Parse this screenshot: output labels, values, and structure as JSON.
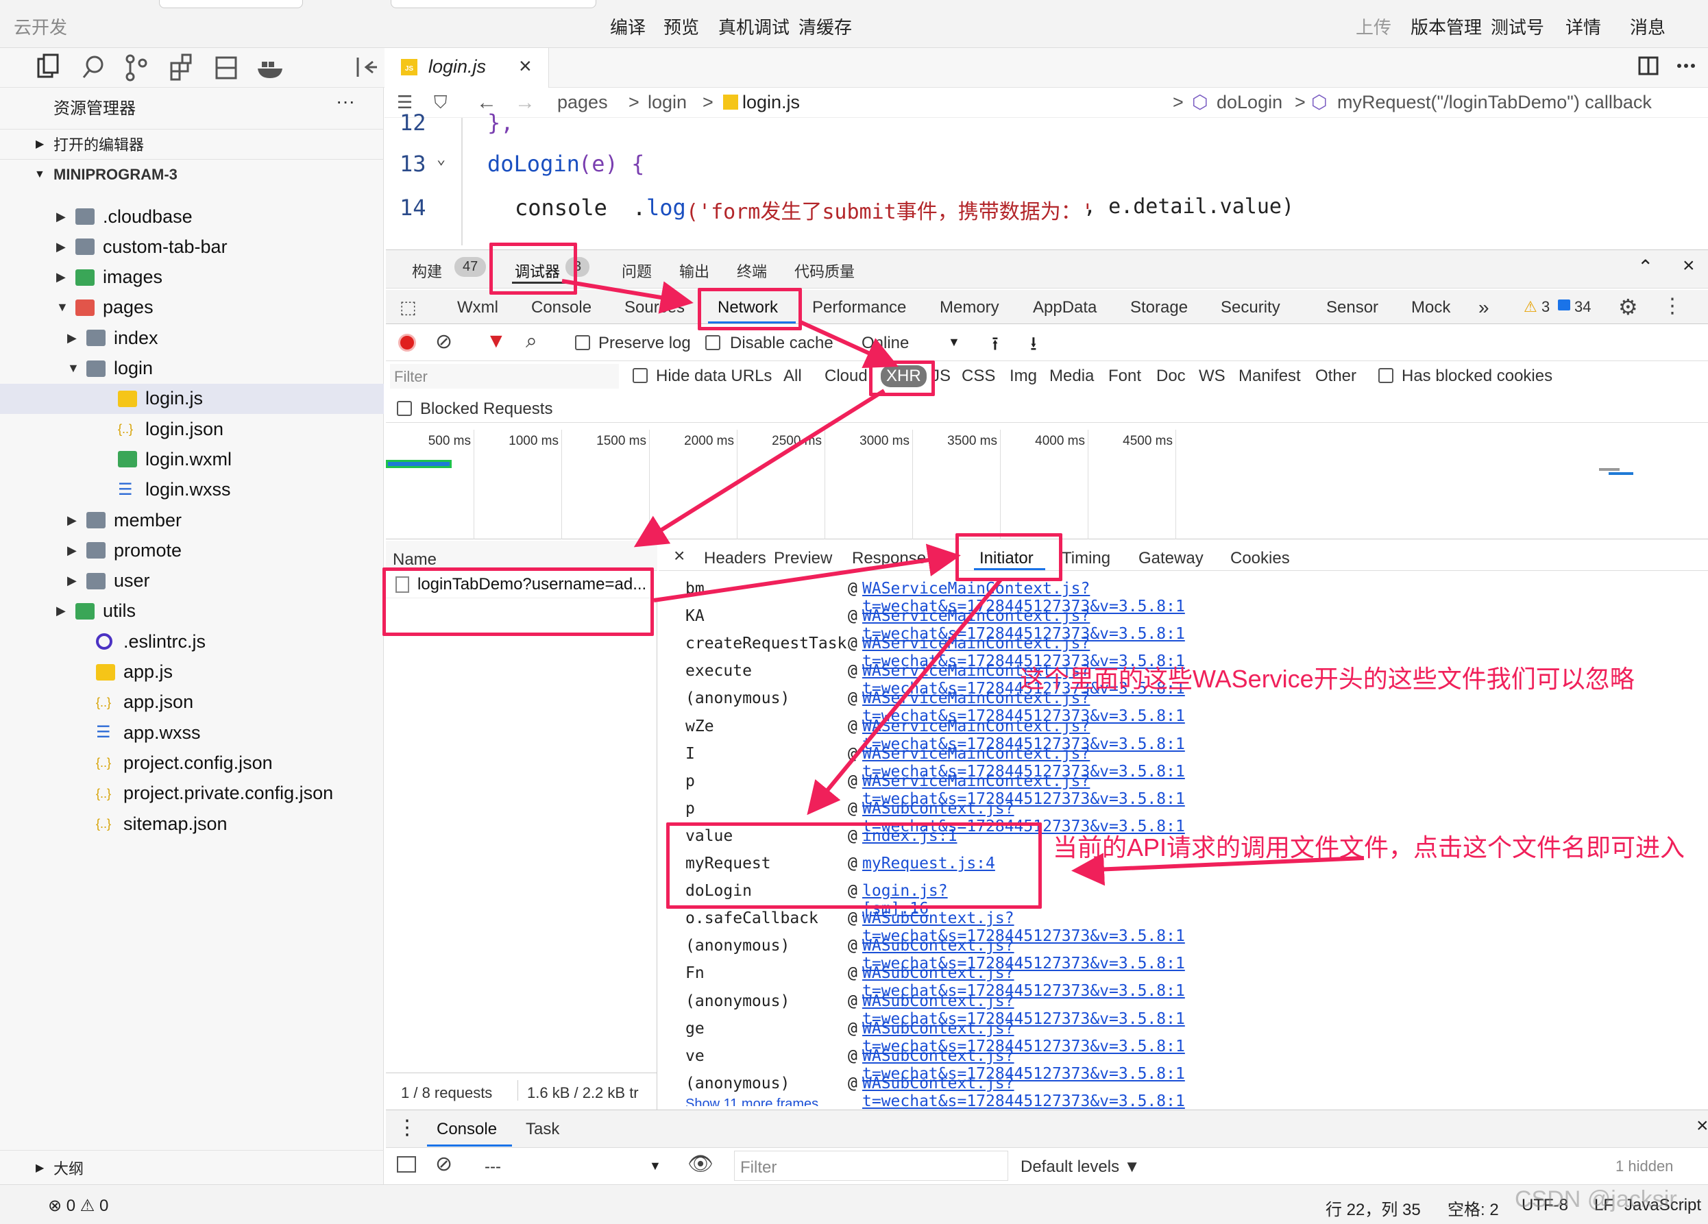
{
  "topbar": {
    "left_title": "云开发",
    "center_buttons": [
      "编译",
      "预览",
      "真机调试",
      "清缓存"
    ],
    "right_buttons": [
      "上传",
      "版本管理",
      "测试号",
      "详情",
      "消息"
    ]
  },
  "editor_tab": {
    "icon": "JS",
    "name": "login.js"
  },
  "breadcrumb": {
    "parts": [
      "pages",
      ">",
      "login",
      ">",
      "login.js",
      ">",
      "doLogin",
      ">",
      "myRequest(\"/loginTabDemo\") callback"
    ]
  },
  "explorer": {
    "title": "资源管理器",
    "more": "···",
    "open_editors": "打开的编辑器",
    "project": "MINIPROGRAM-3",
    "items": [
      {
        "label": ".cloudbase"
      },
      {
        "label": "custom-tab-bar"
      },
      {
        "label": "images"
      },
      {
        "label": "pages"
      },
      {
        "label": "index"
      },
      {
        "label": "login"
      },
      {
        "label": "login.js"
      },
      {
        "label": "login.json"
      },
      {
        "label": "login.wxml"
      },
      {
        "label": "login.wxss"
      },
      {
        "label": "member"
      },
      {
        "label": "promote"
      },
      {
        "label": "user"
      },
      {
        "label": "utils"
      },
      {
        "label": ".eslintrc.js"
      },
      {
        "label": "app.js"
      },
      {
        "label": "app.json"
      },
      {
        "label": "app.wxss"
      },
      {
        "label": "project.config.json"
      },
      {
        "label": "project.private.config.json"
      },
      {
        "label": "sitemap.json"
      }
    ],
    "outline": "大纲",
    "problems": "⊗ 0 ⚠ 0"
  },
  "code": {
    "lines": [
      {
        "num": "12",
        "text": "},"
      },
      {
        "num": "13",
        "text_fn": "doLogin",
        "text_args": "(e) {"
      },
      {
        "num": "14",
        "text_a": "console",
        "text_b": ".",
        "text_c": "log",
        "text_d": "('form发生了submit事件，携带数据为：'",
        "text_e": ", e.detail.value)"
      }
    ]
  },
  "devtools": {
    "panel_tabs": [
      "构建",
      "47",
      "调试器",
      "3",
      "问题",
      "输出",
      "终端",
      "代码质量"
    ],
    "tool_tabs": [
      "Wxml",
      "Console",
      "Sources",
      "Network",
      "Performance",
      "Memory",
      "AppData",
      "Storage",
      "Security",
      "Sensor",
      "Mock",
      "»"
    ],
    "warn_count": "3",
    "info_count": "34",
    "preserve_log": "Preserve log",
    "disable_cache": "Disable cache",
    "throttle": "Online",
    "filter_placeholder": "Filter",
    "hide_data_urls": "Hide data URLs",
    "type_filters": [
      "All",
      "Cloud",
      "XHR",
      "JS",
      "CSS",
      "Img",
      "Media",
      "Font",
      "Doc",
      "WS",
      "Manifest",
      "Other"
    ],
    "has_blocked": "Has blocked cookies",
    "blocked_requests": "Blocked Requests",
    "timeline": [
      "500 ms",
      "1000 ms",
      "1500 ms",
      "2000 ms",
      "2500 ms",
      "3000 ms",
      "3500 ms",
      "4000 ms",
      "4500 ms"
    ],
    "name_header": "Name",
    "request_name": "loginTabDemo?username=ad...",
    "requests_summary": "1 / 8 requests",
    "transfer_summary": "1.6 kB / 2.2 kB tr",
    "detail_tabs": [
      "×",
      "Headers",
      "Preview",
      "Response",
      "Initiator",
      "Timing",
      "Gateway",
      "Cookies"
    ],
    "stack": [
      {
        "fn": "bm",
        "src": "WAServiceMainContext.js?t=wechat&s=1728445127373&v=3.5.8:1"
      },
      {
        "fn": "KA",
        "src": "WAServiceMainContext.js?t=wechat&s=1728445127373&v=3.5.8:1"
      },
      {
        "fn": "createRequestTask",
        "src": "WAServiceMainContext.js?t=wechat&s=1728445127373&v=3.5.8:1"
      },
      {
        "fn": "execute",
        "src": "WAServiceMainContext.js?t=wechat&s=1728445127373&v=3.5.8:1"
      },
      {
        "fn": "(anonymous)",
        "src": "WAServiceMainContext.js?t=wechat&s=1728445127373&v=3.5.8:1"
      },
      {
        "fn": "wZe",
        "src": "WAServiceMainContext.js?t=wechat&s=1728445127373&v=3.5.8:1"
      },
      {
        "fn": "I",
        "src": "WAServiceMainContext.js?t=wechat&s=1728445127373&v=3.5.8:1"
      },
      {
        "fn": "p",
        "src": "WAServiceMainContext.js?t=wechat&s=1728445127373&v=3.5.8:1"
      },
      {
        "fn": "p",
        "src": "WASubContext.js?t=wechat&s=1728445127373&v=3.5.8:1"
      },
      {
        "fn": "value",
        "src": "index.js:1"
      },
      {
        "fn": "myRequest",
        "src": "myRequest.js:4"
      },
      {
        "fn": "doLogin",
        "src": "login.js? [sm]:16"
      },
      {
        "fn": "o.safeCallback",
        "src": "WASubContext.js?t=wechat&s=1728445127373&v=3.5.8:1"
      },
      {
        "fn": "(anonymous)",
        "src": "WASubContext.js?t=wechat&s=1728445127373&v=3.5.8:1"
      },
      {
        "fn": "Fn",
        "src": "WASubContext.js?t=wechat&s=1728445127373&v=3.5.8:1"
      },
      {
        "fn": "(anonymous)",
        "src": "WASubContext.js?t=wechat&s=1728445127373&v=3.5.8:1"
      },
      {
        "fn": "ge",
        "src": "WASubContext.js?t=wechat&s=1728445127373&v=3.5.8:1"
      },
      {
        "fn": "ve",
        "src": "WASubContext.js?t=wechat&s=1728445127373&v=3.5.8:1"
      },
      {
        "fn": "(anonymous)",
        "src": "WASubContext.js?t=wechat&s=1728445127373&v=3.5.8:1"
      }
    ],
    "show_more": "Show 11 more frames",
    "annotation_1": "这个里面的这些WAService开头的这些文件我们可以忽略",
    "annotation_2": "当前的API请求的调用文件文件，点击这个文件名即可进入",
    "drawer_tabs": [
      "Console",
      "Task"
    ],
    "console_context": "---",
    "console_filter": "Filter",
    "levels": "Default levels ▼",
    "hidden": "1 hidden"
  },
  "statusbar": {
    "position": "行 22，列 35",
    "spaces": "空格: 2",
    "encoding": "UTF-8",
    "eol": "LF",
    "lang": "JavaScript",
    "watermark": "CSDN @jacksir"
  },
  "colors": {
    "highlight": "#f0205a",
    "link": "#1a4fd6",
    "selection": "#e4e6f1"
  }
}
